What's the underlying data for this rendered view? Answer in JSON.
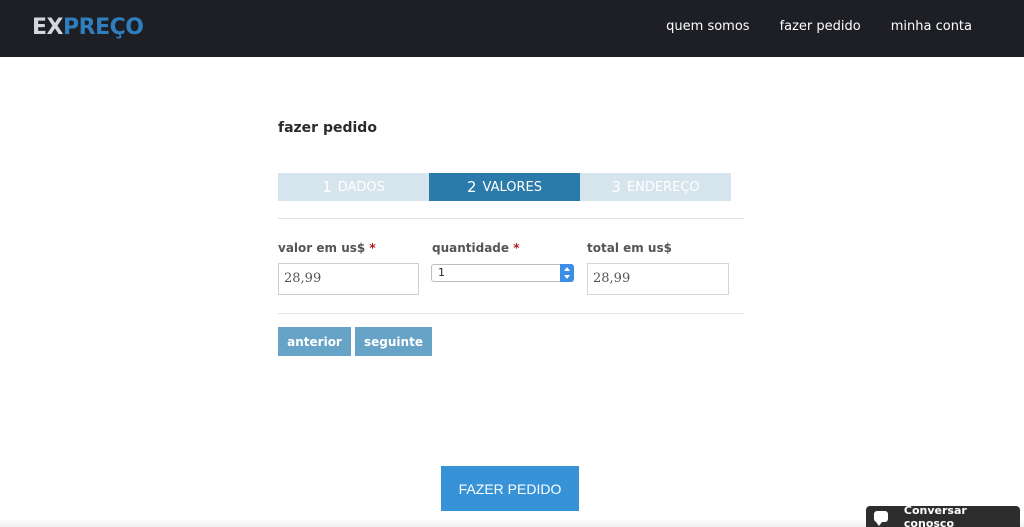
{
  "header": {
    "logo_ex": "EX",
    "logo_preco": "PREÇO",
    "nav": [
      "quem somos",
      "fazer pedido",
      "minha conta"
    ]
  },
  "page_title": "fazer pedido",
  "steps": [
    {
      "num": "1",
      "label": "DADOS",
      "active": false
    },
    {
      "num": "2",
      "label": "VALORES",
      "active": true
    },
    {
      "num": "3",
      "label": "ENDEREÇO",
      "active": false
    }
  ],
  "fields": {
    "valor_label": "valor em us$",
    "valor_value": "28,99",
    "quantidade_label": "quantidade",
    "quantidade_value": "1",
    "total_label": "total em us$",
    "total_value": "28,99",
    "required_mark": "*"
  },
  "buttons": {
    "anterior": "anterior",
    "seguinte": "seguinte",
    "fazer_pedido": "FAZER PEDIDO"
  },
  "chat": {
    "label": "Conversar conosco",
    "icon": "chat-bubble-icon"
  },
  "colors": {
    "topbar": "#1e1f24",
    "active_step": "#2a7aaa",
    "inactive_step": "#d6e4ee",
    "primary_button": "#3792d7",
    "small_button": "#67a3c7"
  }
}
